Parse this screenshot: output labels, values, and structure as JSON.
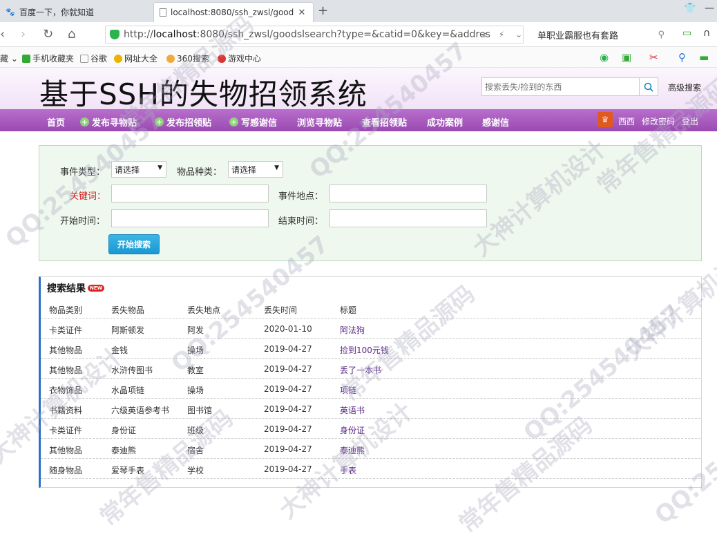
{
  "browser": {
    "tabs": [
      {
        "title": "百度一下，你就知道",
        "icon": "baidu-paw-icon"
      },
      {
        "title": "localhost:8080/ssh_zwsl/good",
        "icon": "page-icon"
      }
    ],
    "url_prefix": "http://",
    "url_host": "localhost",
    "url_rest": ":8080/ssh_zwsl/goodslsearch?type=&catid=0&key=&addres",
    "search_text": "单职业霸服也有套路",
    "bookmarks": [
      "藏",
      "手机收藏夹",
      "谷歌",
      "网址大全",
      "360搜索",
      "游戏中心"
    ]
  },
  "site": {
    "title": "基于SSH的失物招领系统",
    "search_placeholder": "搜索丢失/捡到的东西",
    "advanced_search": "高级搜索",
    "nav": [
      {
        "label": "首页",
        "plus": false
      },
      {
        "label": "发布寻物贴",
        "plus": true
      },
      {
        "label": "发布招领贴",
        "plus": true
      },
      {
        "label": "写感谢信",
        "plus": true
      },
      {
        "label": "浏览寻物贴",
        "plus": false
      },
      {
        "label": "查看招领贴",
        "plus": false
      },
      {
        "label": "成功案例",
        "plus": false
      },
      {
        "label": "感谢信",
        "plus": false
      }
    ],
    "user": {
      "name": "西西",
      "change_password": "修改密码",
      "logout": "登出"
    }
  },
  "form": {
    "event_type_label": "事件类型：",
    "event_type_value": "请选择",
    "item_category_label": "物品种类：",
    "item_category_value": "请选择",
    "keyword_label": "关键词：",
    "location_label": "事件地点：",
    "start_time_label": "开始时间：",
    "end_time_label": "结束时间：",
    "submit_label": "开始搜索"
  },
  "results": {
    "heading": "搜索结果",
    "badge": "NEW",
    "columns": [
      "物品类别",
      "丢失物品",
      "丢失地点",
      "丢失时间",
      "标题"
    ],
    "rows": [
      [
        "卡类证件",
        "阿斯顿发",
        "阿发",
        "2020-01-10",
        "阿法狗"
      ],
      [
        "其他物品",
        "金钱",
        "操场",
        "2019-04-27",
        "捡到100元钱"
      ],
      [
        "其他物品",
        "水浒传图书",
        "教室",
        "2019-04-27",
        "丢了一本书"
      ],
      [
        "衣物饰品",
        "水晶项链",
        "操场",
        "2019-04-27",
        "项链"
      ],
      [
        "书籍资料",
        "六级英语参考书",
        "图书馆",
        "2019-04-27",
        "英语书"
      ],
      [
        "卡类证件",
        "身份证",
        "班级",
        "2019-04-27",
        "身份证"
      ],
      [
        "其他物品",
        "泰迪熊",
        "宿舍",
        "2019-04-27",
        "泰迪熊"
      ],
      [
        "随身物品",
        "爱琴手表",
        "学校",
        "2019-04-27",
        "手表"
      ]
    ]
  },
  "watermark": [
    "QQ:254540457",
    "常年售精品源码",
    "大神计算机设计"
  ]
}
